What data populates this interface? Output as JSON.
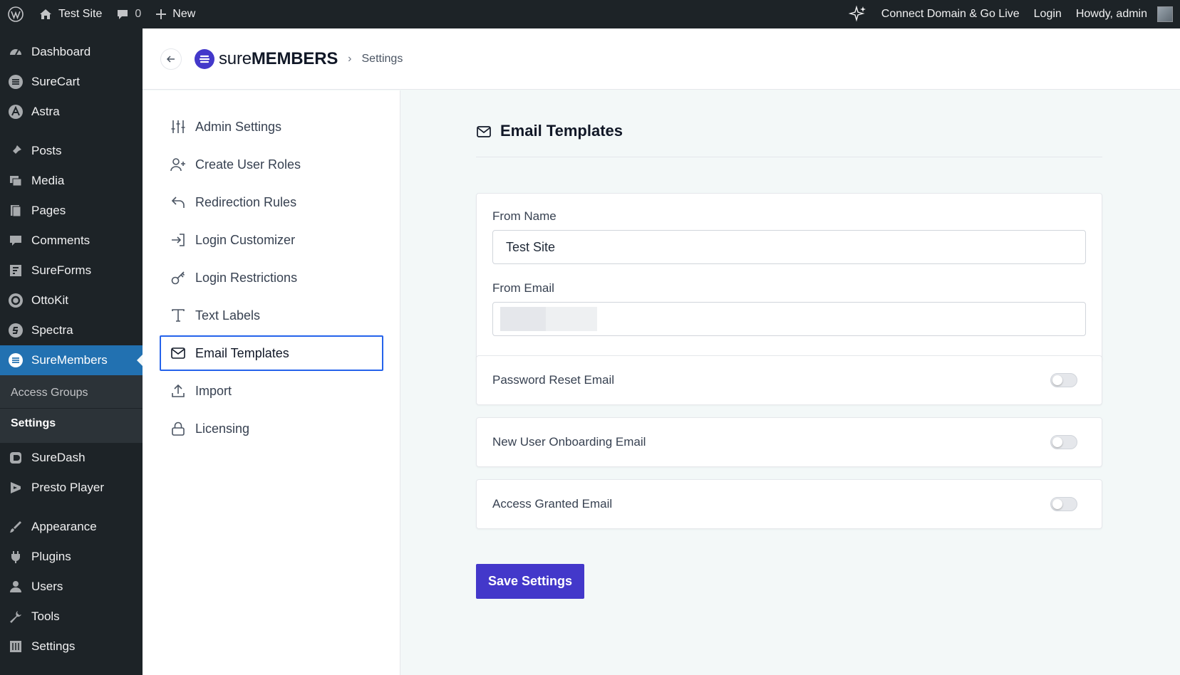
{
  "adminbar": {
    "site_name": "Test Site",
    "comments_count": "0",
    "new_label": "New",
    "connect_label": "Connect Domain & Go Live",
    "login_label": "Login",
    "howdy_label": "Howdy, admin"
  },
  "wpmenu": {
    "items": [
      {
        "label": "Dashboard",
        "icon": "dashboard-icon"
      },
      {
        "label": "SureCart",
        "icon": "surecart-icon"
      },
      {
        "label": "Astra",
        "icon": "astra-icon"
      },
      {
        "label": "Posts",
        "icon": "pin-icon"
      },
      {
        "label": "Media",
        "icon": "media-icon"
      },
      {
        "label": "Pages",
        "icon": "pages-icon"
      },
      {
        "label": "Comments",
        "icon": "comment-icon"
      },
      {
        "label": "SureForms",
        "icon": "sureforms-icon"
      },
      {
        "label": "OttoKit",
        "icon": "ottokit-icon"
      },
      {
        "label": "Spectra",
        "icon": "spectra-icon"
      },
      {
        "label": "SureMembers",
        "icon": "suremembers-icon"
      },
      {
        "label": "SureDash",
        "icon": "suredash-icon"
      },
      {
        "label": "Presto Player",
        "icon": "presto-icon"
      },
      {
        "label": "Appearance",
        "icon": "brush-icon"
      },
      {
        "label": "Plugins",
        "icon": "plug-icon"
      },
      {
        "label": "Users",
        "icon": "user-icon"
      },
      {
        "label": "Tools",
        "icon": "wrench-icon"
      },
      {
        "label": "Settings",
        "icon": "settings-icon"
      }
    ],
    "submenu": [
      "Access Groups",
      "Settings"
    ]
  },
  "header": {
    "logo_light": "sure",
    "logo_bold": "MEMBERS",
    "breadcrumb": "Settings"
  },
  "settings_nav": [
    {
      "label": "Admin Settings",
      "icon": "sliders-icon"
    },
    {
      "label": "Create User Roles",
      "icon": "user-plus-icon"
    },
    {
      "label": "Redirection Rules",
      "icon": "redirect-icon"
    },
    {
      "label": "Login Customizer",
      "icon": "login-icon"
    },
    {
      "label": "Login Restrictions",
      "icon": "key-icon"
    },
    {
      "label": "Text Labels",
      "icon": "text-icon"
    },
    {
      "label": "Email Templates",
      "icon": "mail-icon"
    },
    {
      "label": "Import",
      "icon": "upload-icon"
    },
    {
      "label": "Licensing",
      "icon": "lock-icon"
    }
  ],
  "main": {
    "title": "Email Templates",
    "from_name_label": "From Name",
    "from_name_value": "Test Site",
    "from_email_label": "From Email",
    "toggles": [
      {
        "label": "Password Reset Email",
        "enabled": false
      },
      {
        "label": "New User Onboarding Email",
        "enabled": false
      },
      {
        "label": "Access Granted Email",
        "enabled": false
      }
    ],
    "save_label": "Save Settings"
  },
  "colors": {
    "accent": "#4338ca",
    "wp_active": "#2271b1",
    "wp_dark": "#1d2327",
    "focus_border": "#2563eb"
  }
}
